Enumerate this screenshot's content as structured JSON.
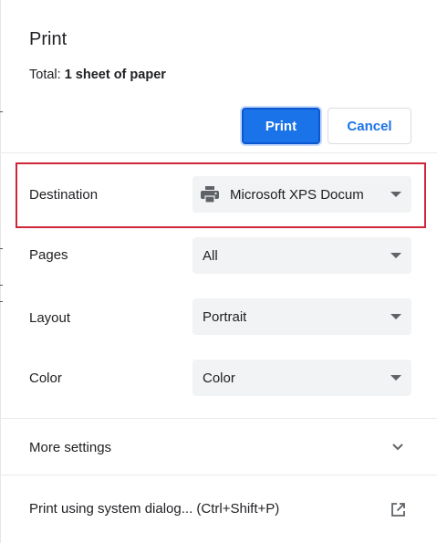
{
  "dialog": {
    "title": "Print",
    "total_label": "Total:",
    "total_value": "1 sheet of paper"
  },
  "buttons": {
    "print_label": "Print",
    "cancel_label": "Cancel"
  },
  "settings": [
    {
      "label": "Destination",
      "value": "Microsoft XPS Docum",
      "icon": "printer-icon"
    },
    {
      "label": "Pages",
      "value": "All"
    },
    {
      "label": "Layout",
      "value": "Portrait"
    },
    {
      "label": "Color",
      "value": "Color"
    }
  ],
  "more_settings": {
    "label": "More settings",
    "icon": "chevron-down-icon"
  },
  "system_dialog": {
    "label": "Print using system dialog... (Ctrl+Shift+P)",
    "icon": "open-in-new-icon"
  },
  "colors": {
    "accent": "#1a73e8",
    "highlight_border": "#d0243a",
    "select_bg": "#f1f3f4"
  }
}
